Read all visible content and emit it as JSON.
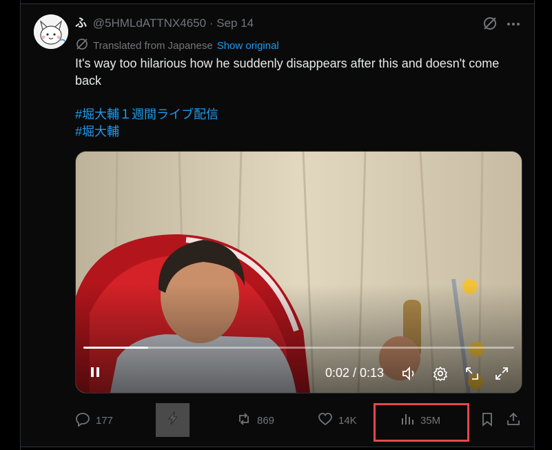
{
  "post": {
    "display_name": "ふ",
    "handle": "@5HMLdATTNX4650",
    "separator": "·",
    "date": "Sep 14",
    "translated_label": "Translated from Japanese",
    "show_original": "Show original",
    "text": "It's way too hilarious how he suddenly disappears after this and doesn't come back",
    "hashtags": [
      "#堀大輔１週間ライブ配信",
      "#堀大輔"
    ]
  },
  "video": {
    "time_display": "0:02 / 0:13",
    "progress_fraction": 0.15,
    "play_state": "playing",
    "controls": [
      "pause-icon",
      "volume-icon",
      "settings-icon",
      "pop-out-icon",
      "fullscreen-icon"
    ]
  },
  "actions": {
    "replies": "177",
    "reposts": "869",
    "likes": "14K",
    "views": "35M"
  },
  "colors": {
    "background": "#000000",
    "text": "#e7e9ea",
    "muted": "#71767b",
    "link": "#1d9bf0",
    "highlight": "#e5484d"
  }
}
